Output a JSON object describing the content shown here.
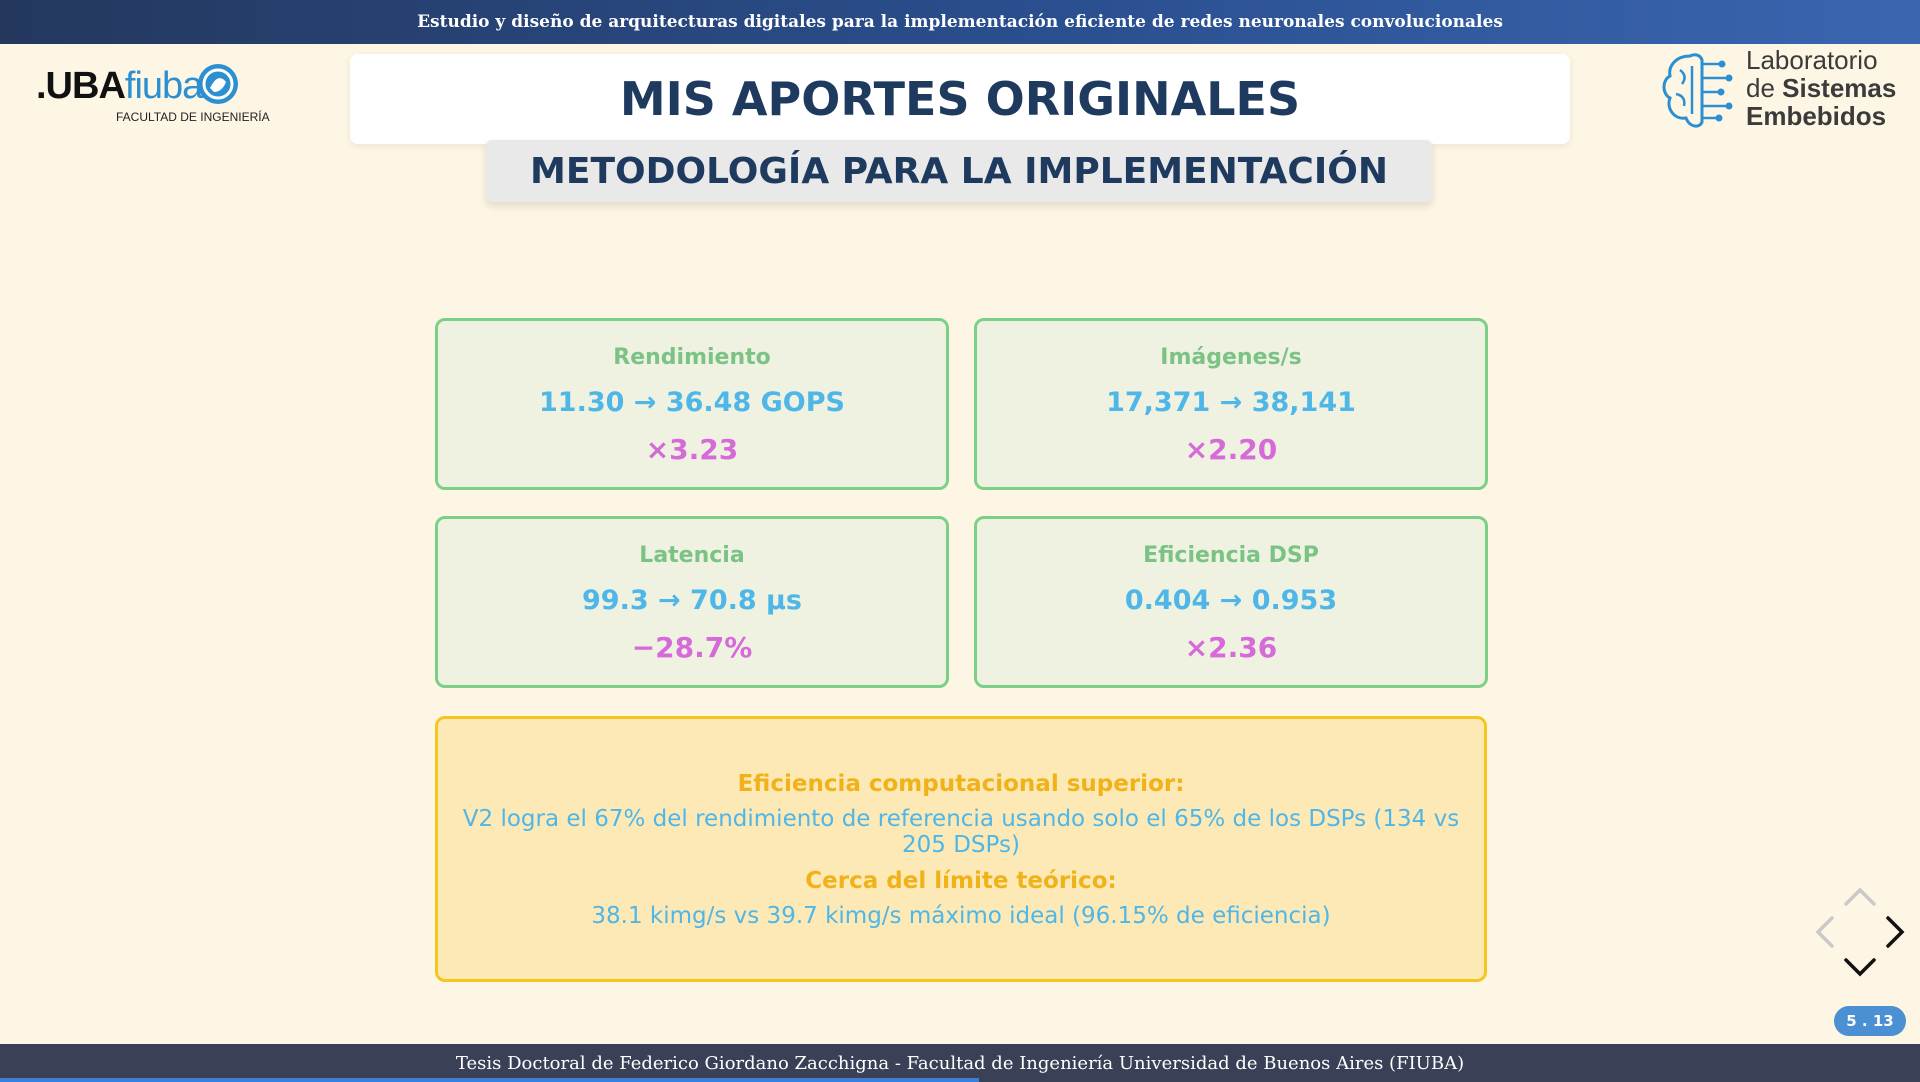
{
  "header": {
    "title": "Estudio y diseño de arquitecturas digitales para la implementación eficiente de redes neuronales convolucionales"
  },
  "logos": {
    "uba_prefix": ".UBA",
    "uba_name": "fiuba",
    "uba_subtitle": "FACULTAD DE INGENIERÍA",
    "lab_line1": "Laboratorio",
    "lab_line2_prefix": "de ",
    "lab_line2_bold": "Sistemas",
    "lab_line3": "Embebidos"
  },
  "slide": {
    "title": "MIS APORTES ORIGINALES",
    "subtitle": "METODOLOGÍA PARA LA IMPLEMENTACIÓN"
  },
  "metrics": [
    {
      "label": "Rendimiento",
      "value": "11.30 → 36.48 GOPS",
      "factor": "×3.23"
    },
    {
      "label": "Imágenes/s",
      "value": "17,371 → 38,141",
      "factor": "×2.20"
    },
    {
      "label": "Latencia",
      "value": "99.3 → 70.8 μs",
      "factor": "−28.7%"
    },
    {
      "label": "Eficiencia DSP",
      "value": "0.404 → 0.953",
      "factor": "×2.36"
    }
  ],
  "highlights": {
    "title1": "Eficiencia computacional superior:",
    "text1": "V2 logra el 67% del rendimiento de referencia usando solo el 65% de los DSPs (134 vs 205 DSPs)",
    "title2": "Cerca del límite teórico:",
    "text2": "38.1 kimg/s vs 39.7 kimg/s máximo ideal (96.15% de eficiencia)"
  },
  "navigation": {
    "slide_counter": "5 . 13"
  },
  "footer": {
    "text": "Tesis Doctoral de Federico Giordano Zacchigna - Facultad de Ingeniería Universidad de Buenos Aires (FIUBA)"
  },
  "progress": {
    "fraction": 0.51
  },
  "colors": {
    "header": "#2a4f8f",
    "title": "#1f3a5f",
    "metric_border": "#7ccf87",
    "metric_label": "#7bc285",
    "metric_value": "#4fb6e8",
    "metric_factor": "#d66ad9",
    "highlight_border": "#f7c520",
    "highlight_title": "#f0b218"
  }
}
